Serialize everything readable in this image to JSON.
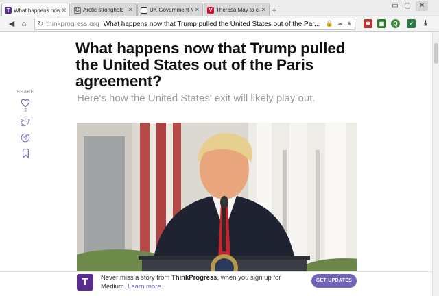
{
  "browser": {
    "tabs": [
      {
        "title": "What happens now t",
        "favicon": "thinkprogress-icon",
        "active": true
      },
      {
        "title": "Arctic stronghold of",
        "favicon": "google-icon",
        "active": false
      },
      {
        "title": "UK Government Mov",
        "favicon": "gov-icon",
        "active": false
      },
      {
        "title": "Theresa May to crea",
        "favicon": "red-news-icon",
        "active": false
      }
    ],
    "new_tab_symbol": "+",
    "address": {
      "domain": "thinkprogress.org",
      "page_title": "What happens now that Trump pulled the United States out of the Par..."
    },
    "accent_color": "#6f64b5",
    "brand_color": "#5b2d8e"
  },
  "article": {
    "headline": "What happens now that Trump pulled the United States out of the Paris agreement?",
    "dek": "Here's how the United States' exit will likely play out.",
    "share": {
      "label": "SHARE",
      "like_count": "3"
    }
  },
  "banner": {
    "logo_letter": "T",
    "text_prefix": "Never miss a story from ",
    "brand": "ThinkProgress",
    "text_suffix": ", when you sign up for Medium. ",
    "link": "Learn more",
    "cta": "GET UPDATES"
  }
}
